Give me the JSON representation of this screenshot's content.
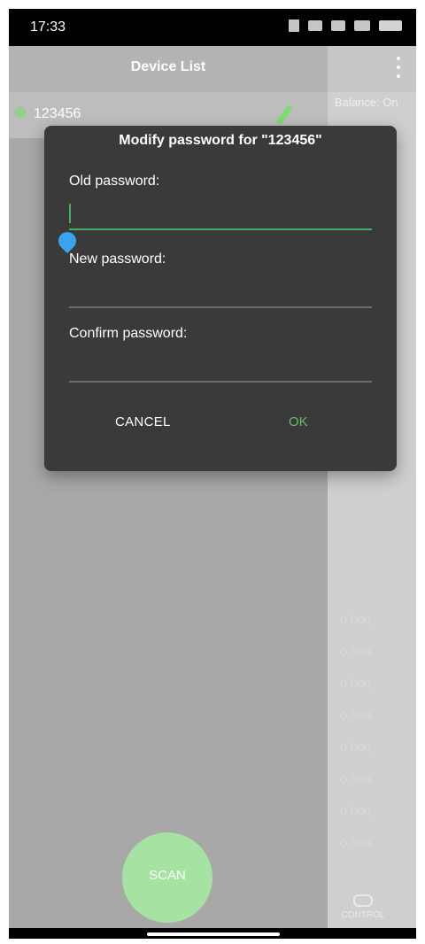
{
  "status_bar": {
    "time": "17:33"
  },
  "drawer": {
    "title": "Device List",
    "devices": [
      {
        "name": "123456"
      }
    ]
  },
  "right_panel": {
    "balance": "Balance: On",
    "values": [
      "0.000",
      "0.000",
      "0.000",
      "0.000",
      "0.000",
      "0.000",
      "0.000",
      "0.000"
    ]
  },
  "dialog": {
    "title": "Modify password for \"123456\"",
    "old_label": "Old password:",
    "new_label": "New password:",
    "confirm_label": "Confirm password:",
    "cancel": "CANCEL",
    "ok": "OK",
    "accent": "#41b35e"
  },
  "scan": {
    "label": "SCAN",
    "color": "#a6e3a2"
  },
  "bottom": {
    "control": "CONTROL"
  },
  "icons": [
    "bluetooth-icon",
    "signal-icon",
    "wifi-icon",
    "battery-icon",
    "more-icon",
    "edit-icon",
    "control-toggle-icon"
  ]
}
